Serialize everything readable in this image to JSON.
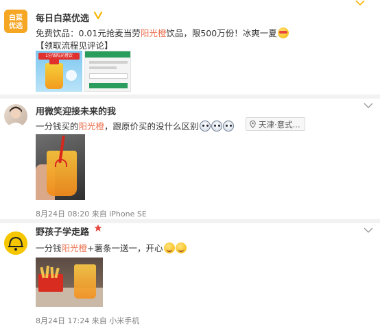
{
  "posts": [
    {
      "username": "每日白菜优选",
      "avatar_text": "白菜\n优选",
      "line1_pre": "免费饮品：0.01元抢麦当劳",
      "line1_hl": "阳光橙",
      "line1_post": "饮品，限500万份！冰爽一夏",
      "line2": "【领取流程见评论】",
      "thumb_banner": "1分钱阳光橙饮"
    },
    {
      "username": "用微笑迎接未来的我",
      "text_pre": "一分钱买的",
      "text_hl": "阳光橙",
      "text_post": "，跟原价买的没什么区别",
      "location": "天津·意式...",
      "time": "8月24日 08:20",
      "source_prefix": "来自",
      "source": "iPhone SE"
    },
    {
      "username": "野孩子学走路",
      "text_pre": "一分钱",
      "text_hl": "阳光橙",
      "text_post": "+薯条一送一，开心",
      "time": "8月24日 17:24",
      "source_prefix": "来自",
      "source": "小米手机"
    }
  ],
  "colors": {
    "highlight": "#eb7350",
    "verified": "#f7b500",
    "separator": "#f2f2f2",
    "avatar_bg_1": "#f5a623",
    "avatar_bg_3": "#f6c700"
  },
  "icons": [
    "verified-icon",
    "chevron-down-icon",
    "location-pin-icon",
    "star-badge-icon",
    "cool-emoji-icon",
    "doge-emoji-icon",
    "smile-emoji-icon"
  ]
}
